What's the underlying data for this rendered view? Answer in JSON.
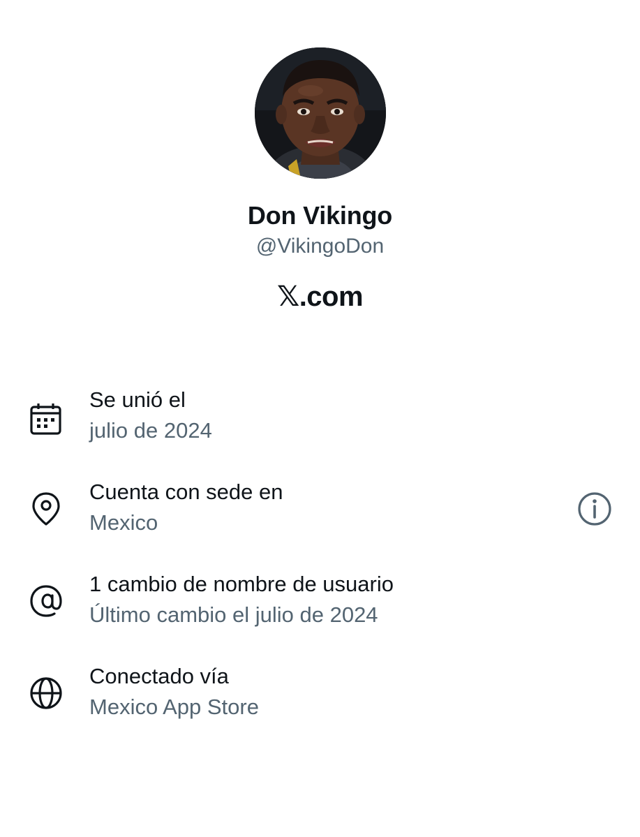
{
  "profile": {
    "display_name": "Don Vikingo",
    "handle": "@VikingoDon",
    "site_label": ".com",
    "site_mark": "𝕏"
  },
  "details": [
    {
      "icon": "calendar-icon",
      "title": "Se unió el",
      "value": "julio de 2024"
    },
    {
      "icon": "location-pin-icon",
      "title": "Cuenta con sede en",
      "value": "Mexico",
      "info_icon": "info-icon"
    },
    {
      "icon": "at-sign-icon",
      "title": "1 cambio de nombre de usuario",
      "value": "Último cambio el julio de 2024"
    },
    {
      "icon": "globe-icon",
      "title": "Conectado vía",
      "value": "Mexico App Store"
    }
  ],
  "colors": {
    "primary_text": "#0f1419",
    "secondary_text": "#536471",
    "background": "#ffffff"
  }
}
